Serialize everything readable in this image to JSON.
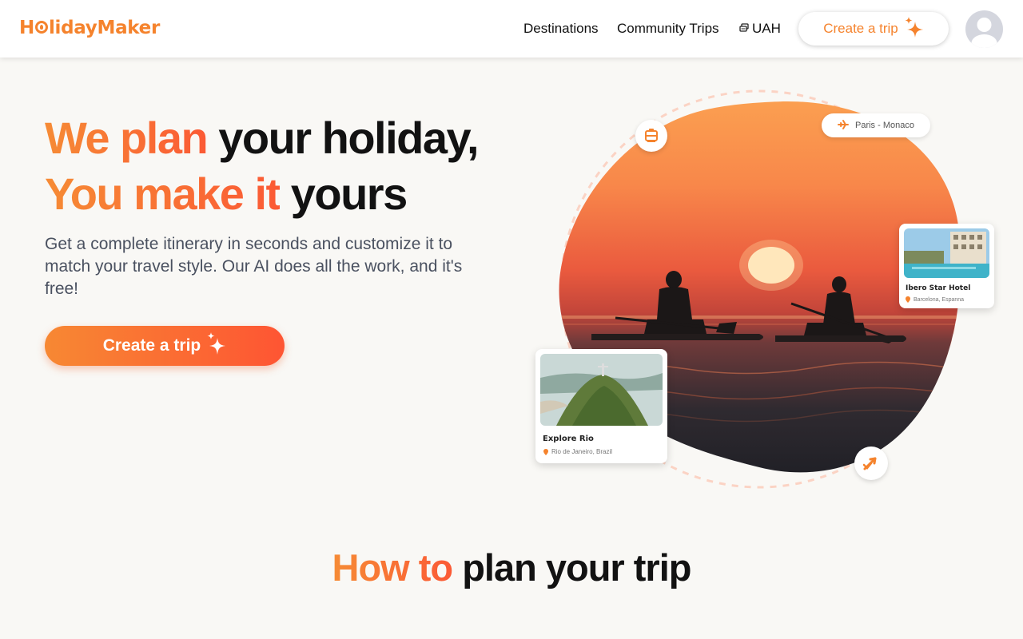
{
  "header": {
    "logo_text": "HolidayMaker",
    "nav": {
      "destinations": "Destinations",
      "community_trips": "Community Trips",
      "currency": "UAH",
      "currency_icon": "money-stack-icon"
    },
    "create_trip_label": "Create a trip",
    "avatar_icon": "user-avatar-icon"
  },
  "hero": {
    "line1_accent": "We plan",
    "line1_rest": " your holiday,",
    "line2_accent": "You make it",
    "line2_rest": " yours",
    "subtitle": "Get a complete itinerary in seconds and customize it to match your travel style. Our AI does all the work, and it's free!",
    "cta_label": "Create a trip",
    "cta_icon": "sparkle-icon"
  },
  "illustration": {
    "route_pill": "Paris - Monaco",
    "route_icon": "plane-icon",
    "top_icon": "luggage-icon",
    "bottom_icon": "plane-check-icon",
    "hotel_card": {
      "title": "Ibero Star Hotel",
      "location": "Barcelona, Espanna"
    },
    "rio_card": {
      "title": "Explore Rio",
      "location": "Rio de Janeiro, Brazil"
    }
  },
  "section": {
    "title_accent": "How to",
    "title_rest": " plan your trip"
  },
  "colors": {
    "brand_orange": "#f5832d",
    "gradient_start": "#f78833",
    "gradient_end": "#fe5533",
    "background": "#f9f8f5",
    "text_dark": "#121212",
    "text_muted": "#4a5160"
  }
}
